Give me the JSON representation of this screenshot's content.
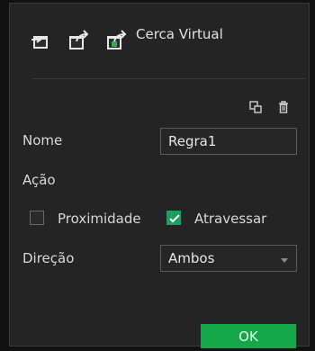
{
  "header": {
    "title": "Cerca Virtual",
    "icons": [
      "import-icon",
      "export-icon",
      "export-green-icon"
    ]
  },
  "toolbar": {
    "icons": [
      "copy-icon",
      "delete-icon"
    ]
  },
  "form": {
    "name_label": "Nome",
    "name_value": "Regra1",
    "action_label": "Ação",
    "proximity_label": "Proximidade",
    "proximity_checked": false,
    "cross_label": "Atravessar",
    "cross_checked": true,
    "direction_label": "Direção",
    "direction_value": "Ambos"
  },
  "footer": {
    "ok_label": "OK"
  },
  "colors": {
    "accent": "#14a84a",
    "background": "#242424"
  }
}
